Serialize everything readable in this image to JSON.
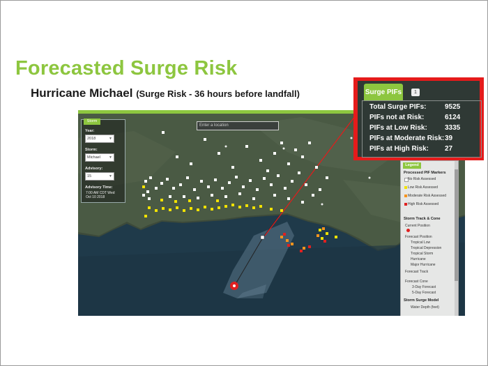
{
  "slide": {
    "title": "Forecasted Surge Risk",
    "subtitle_main": "Hurricane Michael",
    "subtitle_note": "(Surge Risk - 36 hours before landfall)"
  },
  "map": {
    "search_placeholder": "Enter a location",
    "storm_panel": {
      "tab_label": "Storm",
      "year_label": "Year:",
      "year_value": "2018",
      "storm_label": "Storm:",
      "storm_value": "Michael",
      "advisory_label": "Advisory:",
      "advisory_value": "15",
      "advisory_time_label": "Advisory Time:",
      "advisory_time_line1": "7:00 AM CDT Wed",
      "advisory_time_line2": "Oct 10 2018"
    },
    "legend": {
      "tab_label": "Legend",
      "pif_header": "Processed PIF Markers",
      "pif_items": [
        {
          "label": "No Risk Assessed",
          "color": "#ffffff"
        },
        {
          "label": "Low Risk Assessed",
          "color": "#f2e200"
        },
        {
          "label": "Moderate Risk Assessed",
          "color": "#f7941d"
        },
        {
          "label": "High Risk Assessed",
          "color": "#e02020"
        }
      ],
      "track_header": "Storm Track & Cone",
      "current_position": "Current Position",
      "forecast_position": "Forecast Position",
      "position_items": [
        "Tropical Low",
        "Tropical Depression",
        "Tropical Storm",
        "Hurricane",
        "Major Hurricane"
      ],
      "forecast_track": "Forecast Track",
      "forecast_cone": "Forecast Cone",
      "cone_items": [
        "3-Day Forecast",
        "5-Day Forecast"
      ],
      "surge_header": "Storm Surge Model",
      "surge_item": "Water Depth (feet)"
    }
  },
  "popup": {
    "tab_label": "Surge PIFs",
    "shield_text": "1",
    "rows": [
      {
        "label": "Total Surge PIFs:",
        "value": "9525"
      },
      {
        "label": "PIFs not at Risk:",
        "value": "6124"
      },
      {
        "label": "PIFs at Low Risk:",
        "value": "3335"
      },
      {
        "label": "PIFs at Moderate Risk:",
        "value": "39"
      },
      {
        "label": "PIFs at High Risk:",
        "value": "27"
      }
    ]
  },
  "colors": {
    "title_green": "#8dc63f",
    "popup_border": "#e51b1b",
    "low_risk": "#f2e200",
    "moderate_risk": "#f7941d",
    "high_risk": "#e02020"
  }
}
